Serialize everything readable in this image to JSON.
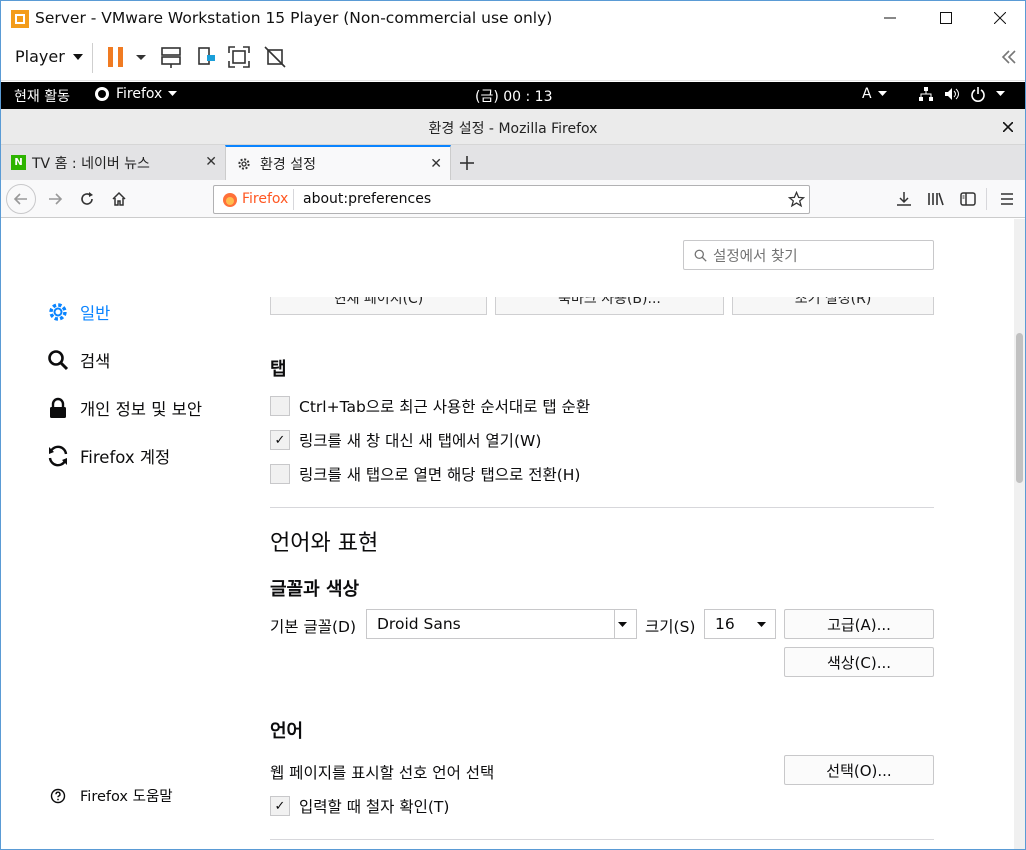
{
  "window": {
    "title": "Server - VMware Workstation 15 Player (Non-commercial use only)"
  },
  "vmware": {
    "player_label": "Player"
  },
  "gnome": {
    "activities": "현재 활동",
    "app": "Firefox",
    "clock": "(금) 00 : 13",
    "input": "A"
  },
  "firefox": {
    "window_title": "환경 설정 - Mozilla Firefox",
    "tabs": [
      {
        "label": "TV 홈 : 네이버 뉴스",
        "icon": "N"
      },
      {
        "label": "환경 설정"
      }
    ],
    "identity_label": "Firefox",
    "url": "about:preferences"
  },
  "prefs": {
    "search_placeholder": "설정에서 찾기",
    "categories": [
      {
        "label": "일반"
      },
      {
        "label": "검색"
      },
      {
        "label": "개인 정보 및 보안"
      },
      {
        "label": "Firefox 계정"
      }
    ],
    "help": "Firefox 도움말",
    "top_buttons": [
      "현재 페이지(C)",
      "북마크 사용(B)...",
      "초기 설정(R)"
    ],
    "tabs_heading": "탭",
    "tab_options": [
      {
        "label": "Ctrl+Tab으로 최근 사용한 순서대로 탭 순환",
        "checked": false
      },
      {
        "label": "링크를 새 창 대신 새 탭에서 열기(W)",
        "checked": true
      },
      {
        "label": "링크를 새 탭으로 열면 해당 탭으로 전환(H)",
        "checked": false
      }
    ],
    "lang_section": "언어와 표현",
    "fonts_heading": "글꼴과 색상",
    "default_font_label": "기본 글꼴(D)",
    "default_font": "Droid Sans",
    "size_label": "크기(S)",
    "size": "16",
    "advanced_button": "고급(A)...",
    "colors_button": "색상(C)...",
    "language_heading": "언어",
    "language_desc": "웹 페이지를 표시할 선호 언어 선택",
    "choose_button": "선택(O)...",
    "spellcheck": {
      "label": "입력할 때 철자 확인(T)",
      "checked": true
    }
  }
}
